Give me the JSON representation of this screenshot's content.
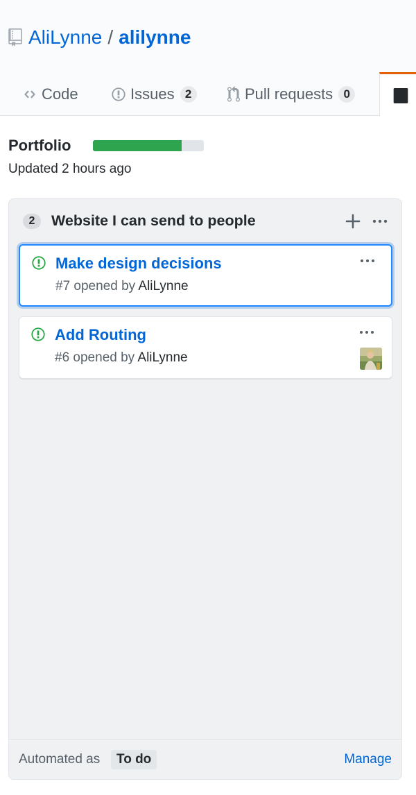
{
  "repo": {
    "owner": "AliLynne",
    "separator": "/",
    "name": "alilynne",
    "icon": "repo-icon"
  },
  "tabs": [
    {
      "label": "Code",
      "icon": "code-icon",
      "count": null,
      "selected": false
    },
    {
      "label": "Issues",
      "icon": "issue-opened-icon",
      "count": "2",
      "selected": false
    },
    {
      "label": "Pull requests",
      "icon": "git-pull-request-icon",
      "count": "0",
      "selected": false
    },
    {
      "label": "",
      "icon": "project-icon",
      "count": null,
      "selected": true
    }
  ],
  "project": {
    "name": "Portfolio",
    "progress_fraction": 0.8,
    "updated": "Updated 2 hours ago"
  },
  "column": {
    "count": "2",
    "title": "Website I can send to people",
    "cards": [
      {
        "title": "Make design decisions",
        "number": "#7",
        "opened_text": "opened by",
        "author": "AliLynne",
        "selected": true,
        "has_avatar": false
      },
      {
        "title": "Add Routing",
        "number": "#6",
        "opened_text": "opened by",
        "author": "AliLynne",
        "selected": false,
        "has_avatar": true
      }
    ],
    "footer": {
      "automated_label": "Automated as",
      "automated_value": "To do",
      "manage": "Manage"
    }
  },
  "colors": {
    "link": "#0366d6",
    "progress": "#2ea44f",
    "open_issue": "#28a745",
    "selected_tab_accent": "#e36209",
    "selected_card_border": "#2188ff"
  }
}
